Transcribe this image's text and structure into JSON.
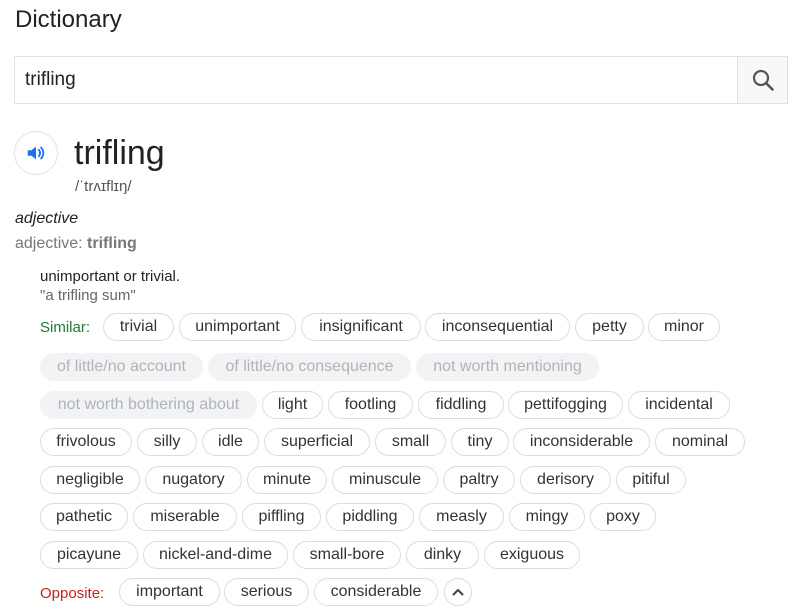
{
  "header": {
    "title": "Dictionary"
  },
  "search": {
    "value": "trifling"
  },
  "entry": {
    "word": "trifling",
    "phonetic": "/ˈtrʌɪflɪŋ/",
    "pos": "adjective",
    "subpos_prefix": "adjective: ",
    "subpos_word": "trifling",
    "definition": "unimportant or trivial.",
    "example": "\"a trifling sum\""
  },
  "similar": {
    "label": "Similar:",
    "chips": [
      "trivial",
      "unimportant",
      "insignificant",
      "inconsequential",
      "petty",
      "minor",
      "of little/no account",
      "of little/no consequence",
      "not worth mentioning",
      "not worth bothering about",
      "light",
      "footling",
      "fiddling",
      "pettifogging",
      "incidental",
      "frivolous",
      "silly",
      "idle",
      "superficial",
      "small",
      "tiny",
      "inconsiderable",
      "nominal",
      "negligible",
      "nugatory",
      "minute",
      "minuscule",
      "paltry",
      "derisory",
      "pitiful",
      "pathetic",
      "miserable",
      "piffling",
      "piddling",
      "measly",
      "mingy",
      "poxy",
      "picayune",
      "nickel-and-dime",
      "small-bore",
      "dinky",
      "exiguous"
    ]
  },
  "opposite": {
    "label": "Opposite:",
    "chips": [
      "important",
      "serious",
      "considerable"
    ]
  },
  "colors": {
    "similar_label": "#1e7a35",
    "opposite_label": "#c5221f",
    "speaker": "#1a73e8"
  }
}
